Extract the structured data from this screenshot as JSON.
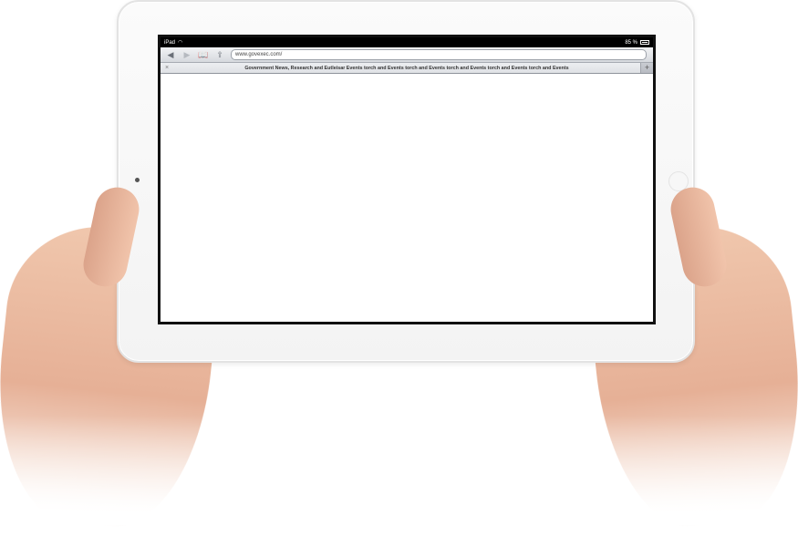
{
  "status_bar": {
    "device": "iPad",
    "wifi_icon": "wifi-icon",
    "battery_text": "85 %",
    "battery_icon": "battery-icon"
  },
  "toolbar": {
    "back_icon": "back-arrow-icon",
    "forward_icon": "forward-arrow-icon",
    "bookmarks_icon": "bookmarks-book-icon",
    "share_icon": "share-icon",
    "url": "www.govexec.com/"
  },
  "tabs": {
    "active_title": "Government News, Research and Eutleisar Events torch and Events torch and Events torch and Events torch and Events torch and Events",
    "close_symbol": "×",
    "new_tab_symbol": "+"
  }
}
